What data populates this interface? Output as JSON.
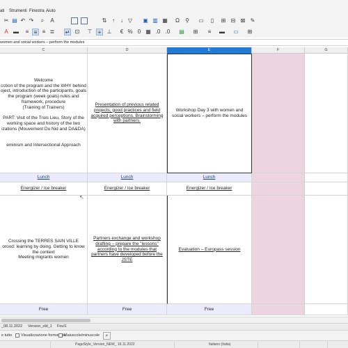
{
  "menubar": {
    "items": [
      "ati",
      "Strumenti",
      "Finestra",
      "Aiuto"
    ]
  },
  "formula_bar": {
    "content": "women and social workers – perform the modules"
  },
  "columns": [
    "C",
    "D",
    "E",
    "F",
    "G"
  ],
  "selected_column": "E",
  "rows": {
    "row1": {
      "c": "Welcome\ncction of the program and the WHY behind\noject, introduction of the participants, goals\nthe program (week goals) rules and\nframework, procedure\n(Training of Trainers)\n\n PART: Visit of the Trois Lieu, Story of the\nworking space and history of the two\nizations (Mouvement Du Nid and DA&DA)\n\n\neminism and Intersectional Approach",
      "d": "Presentation of previous related\nprojects, good practices and field\nacquired perceptions. Brainstorming\nwith partners.",
      "e": "Workshop Day 3 with women and\nsocial workers – perform the modules"
    },
    "lunch": {
      "c": "Lunch",
      "d": "Lunch",
      "e": "Lunch"
    },
    "energizer": {
      "c": "Energizer / Ice breaker",
      "d": "Energizer / Ice breaker",
      "e": "Energizer / Ice breaker"
    },
    "row4": {
      "c": "Crossing the TERRES SAIN VILLE\norood:  learning by doing. Getting to know\nthe context\nMeeting migrants women",
      "d": "Partners exchange and workshop\ndrafting – prepare the \"lessons\"\naccording to the modules that\npartners have developed before the\nJSTE",
      "e": "Evaluation – Europass session"
    },
    "free": {
      "c": "Free",
      "d": "Free",
      "e": "Free"
    }
  },
  "sheet_tabs": [
    "_08.11.2022",
    "Version_old_1",
    "Foul1"
  ],
  "findbar": {
    "search_all": "e tutto",
    "formatted_display": "Visualizzazione formattata",
    "match_case": "Maiuscole/minuscole"
  },
  "statusbar": {
    "page_style": "PageStyle_Version_NEW_ 16.11.2022",
    "language": "Italiano (Italia)"
  },
  "colors": {
    "accent": "#1f7ad8",
    "lavender": "#ecebfb",
    "pink": "#ecd5e0",
    "link": "#1a3d8a"
  }
}
